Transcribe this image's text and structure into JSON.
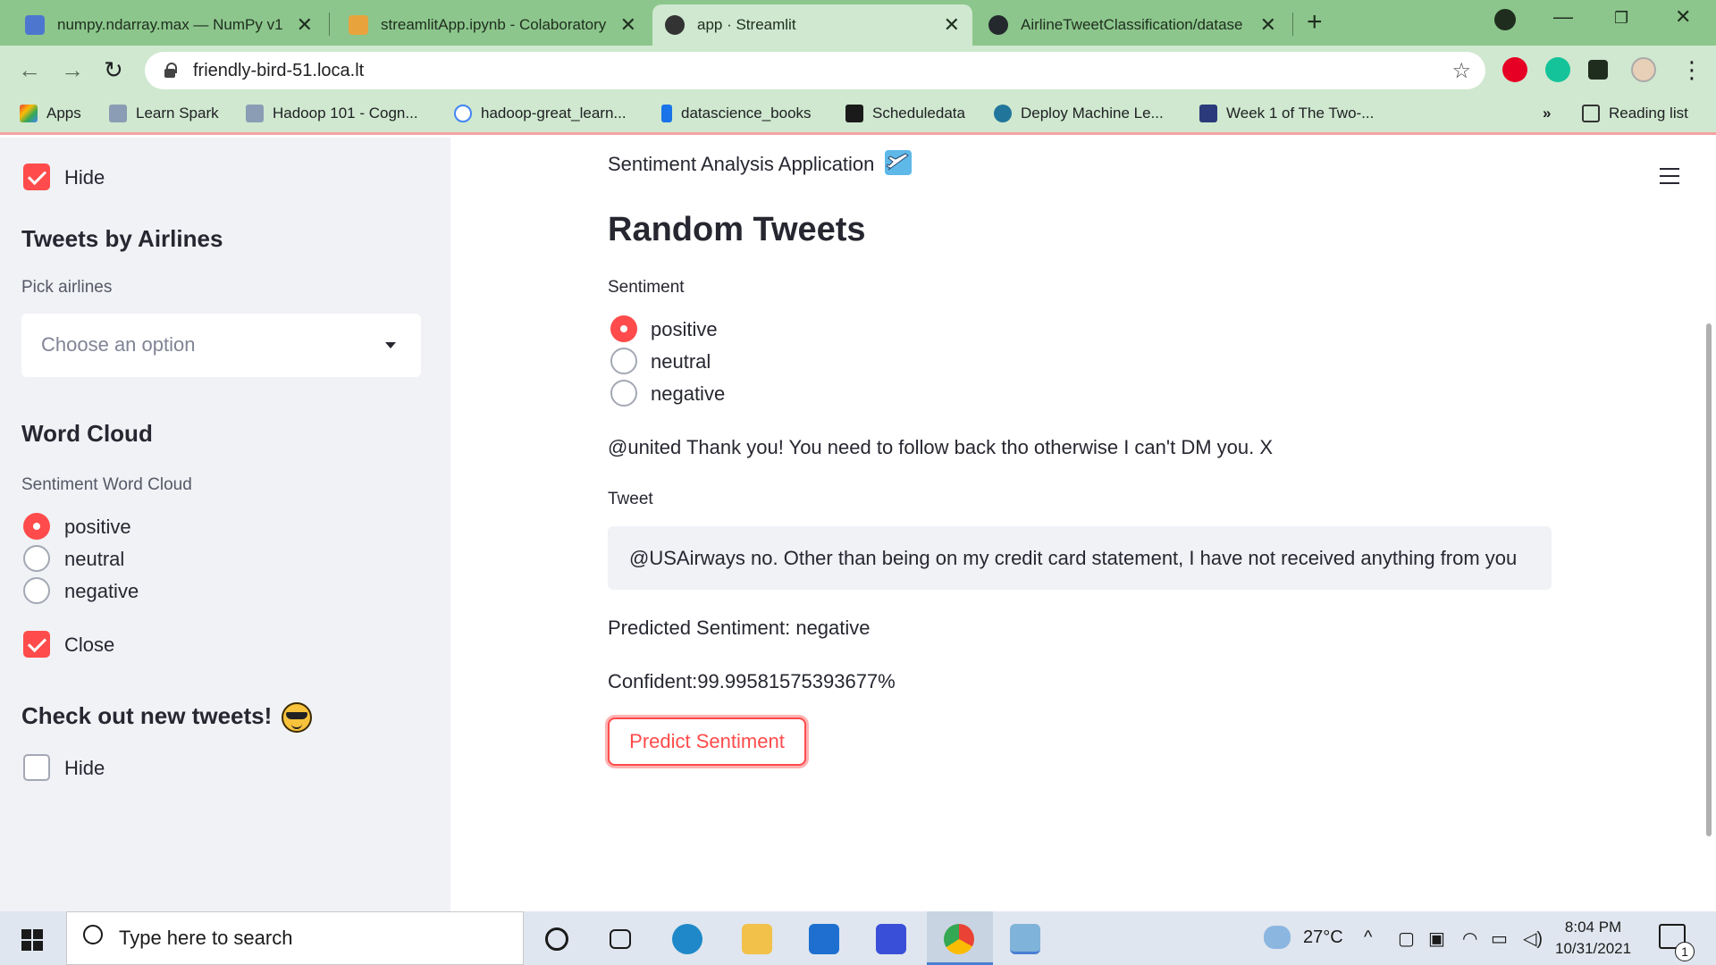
{
  "browser": {
    "tabs": [
      {
        "title": "numpy.ndarray.max — NumPy v1",
        "icon": "numpy-favicon"
      },
      {
        "title": "streamlitApp.ipynb - Colaboratory",
        "icon": "colab-favicon"
      },
      {
        "title": "app · Streamlit",
        "icon": "streamlit-favicon",
        "active": true
      },
      {
        "title": "AirlineTweetClassification/datase",
        "icon": "github-favicon"
      }
    ],
    "url": "friendly-bird-51.loca.lt",
    "bookmarks": [
      {
        "label": "Apps",
        "icon": "apps-grid-icon"
      },
      {
        "label": "Learn Spark",
        "icon": "folder-icon"
      },
      {
        "label": "Hadoop 101 - Cogn...",
        "icon": "folder-icon"
      },
      {
        "label": "hadoop-great_learn...",
        "icon": "google-icon"
      },
      {
        "label": "datascience_books",
        "icon": "k-icon"
      },
      {
        "label": "Scheduledata",
        "icon": "angular-icon"
      },
      {
        "label": "Deploy Machine Le...",
        "icon": "wordpress-icon"
      },
      {
        "label": "Week 1 of The Two-...",
        "icon": "graduation-cap-icon"
      }
    ],
    "overflow": "»",
    "reading_list": "Reading list"
  },
  "sidebar": {
    "hide1": "Hide",
    "tweets_by_airlines": "Tweets by Airlines",
    "pick_airlines": "Pick airlines",
    "select_placeholder": "Choose an option",
    "word_cloud": "Word Cloud",
    "sentiment_word_cloud": "Sentiment Word Cloud",
    "wc_options": [
      "positive",
      "neutral",
      "negative"
    ],
    "wc_selected": "positive",
    "close": "Close",
    "check_out": "Check out new tweets!",
    "hide2": "Hide"
  },
  "main": {
    "app_title": "Sentiment Analysis Application",
    "heading": "Random Tweets",
    "sentiment_label": "Sentiment",
    "sentiment_options": [
      "positive",
      "neutral",
      "negative"
    ],
    "sentiment_selected": "positive",
    "random_tweet": "@united Thank you! You need to follow back tho otherwise I can't DM you. X",
    "tweet_label": "Tweet",
    "tweet_value": "@USAirways no. Other than being on my credit card statement, I have not received anything from you",
    "predicted": "Predicted Sentiment: negative",
    "confidence": "Confident:99.99581575393677%",
    "predict_button": "Predict Sentiment"
  },
  "taskbar": {
    "search_placeholder": "Type here to search",
    "temperature": "27°C",
    "time": "8:04 PM",
    "date": "10/31/2021",
    "notification_count": "1"
  },
  "colors": {
    "accent": "#ff4b4b",
    "sidebar_bg": "#f0f2f6",
    "chrome_green": "#8cc68c"
  }
}
